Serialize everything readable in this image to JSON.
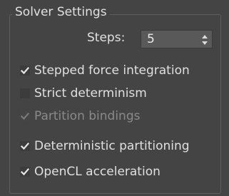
{
  "group": {
    "title": "Solver Settings"
  },
  "steps": {
    "label": "Steps:",
    "value": "5"
  },
  "options": [
    {
      "label": "Stepped force integration",
      "checked": true,
      "enabled": true
    },
    {
      "label": "Strict determinism",
      "checked": false,
      "enabled": true
    },
    {
      "label": "Partition bindings",
      "checked": true,
      "enabled": false
    },
    {
      "label": "Deterministic partitioning",
      "checked": true,
      "enabled": true
    },
    {
      "label": "OpenCL acceleration",
      "checked": true,
      "enabled": true
    }
  ],
  "colors": {
    "background": "#444444",
    "text": "#e0e0e0",
    "disabled_text": "#8a8a8a",
    "checkbox_bg": "#3c3c3c",
    "check_mark": "#e6e6e6"
  }
}
